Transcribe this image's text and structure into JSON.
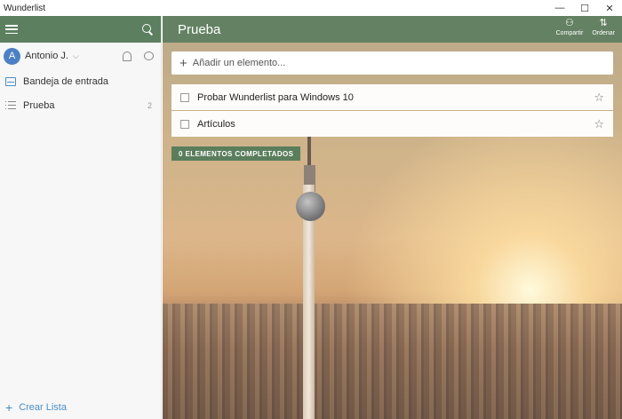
{
  "window": {
    "title": "Wunderlist",
    "minimize": "—",
    "maximize": "☐",
    "close": "✕"
  },
  "sidebar": {
    "user": {
      "initial": "A",
      "name": "Antonio J.",
      "chevron": "⌵"
    },
    "items": [
      {
        "label": "Bandeja de entrada",
        "count": ""
      },
      {
        "label": "Prueba",
        "count": "2"
      }
    ],
    "create_list": "Crear Lista"
  },
  "main": {
    "list_title": "Prueba",
    "actions": [
      {
        "label": "Compartir",
        "icon": "share-user-icon"
      },
      {
        "label": "Ordenar",
        "icon": "sort-icon"
      }
    ],
    "add_placeholder": "Añadir un elemento...",
    "tasks": [
      {
        "title": "Probar Wunderlist para Windows 10",
        "starred": false
      },
      {
        "title": "Artículos",
        "starred": false
      }
    ],
    "completed_label": "0 ELEMENTOS COMPLETADOS"
  },
  "colors": {
    "header": "#5c7f5f",
    "accent": "#4a8fc4",
    "completed": "#5a7d5c"
  }
}
